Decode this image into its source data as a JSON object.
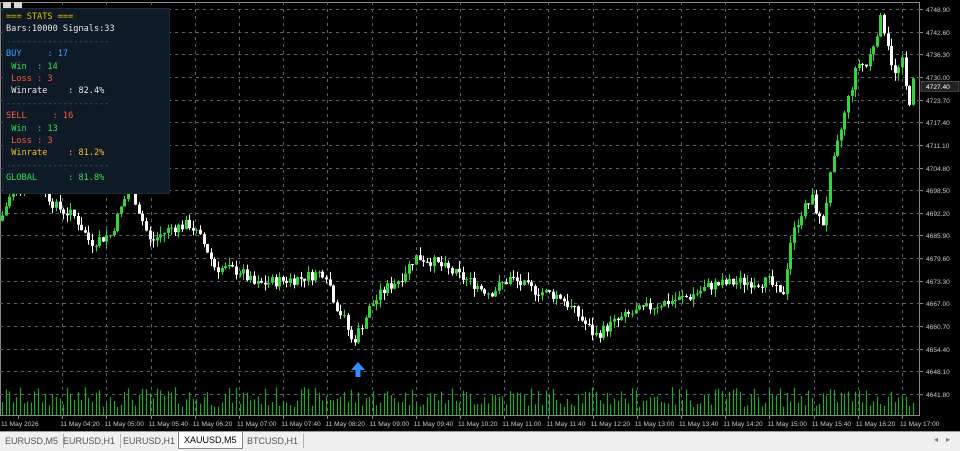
{
  "stats": {
    "title": "=== STATS ===",
    "bars_signals": "Bars:10000 Signals:33",
    "separator": "--------------------",
    "buy": {
      "label": "BUY",
      "count": "17",
      "win": "14",
      "loss": "3",
      "winrate": "82.4%"
    },
    "sell": {
      "label": "SELL",
      "count": "16",
      "win": "13",
      "loss": "3",
      "winrate": "81.2%"
    },
    "win_label": "Win",
    "loss_label": "Loss",
    "winrate_label": "Winrate",
    "global_label": "GLOBAL",
    "global_rate": "81.8%"
  },
  "price_axis": [
    "4748.90",
    "4742.60",
    "4736.30",
    "4730.00",
    "4723.70",
    "4717.40",
    "4711.10",
    "4704.80",
    "4698.50",
    "4692.20",
    "4685.90",
    "4679.60",
    "4673.30",
    "4667.00",
    "4660.70",
    "4654.40",
    "4648.10",
    "4641.80"
  ],
  "time_axis": [
    "11 May 2026",
    "11 May 04:20",
    "11 May 05:00",
    "11 May 05:40",
    "11 May 06:20",
    "11 May 07:00",
    "11 May 07:40",
    "11 May 08:20",
    "11 May 09:00",
    "11 May 09:40",
    "11 May 10:20",
    "11 May 11:00",
    "11 May 11:40",
    "11 May 12:20",
    "11 May 13:00",
    "11 May 13:40",
    "11 May 14:20",
    "11 May 15:00",
    "11 May 15:40",
    "11 May 16:20",
    "11 May 17:00"
  ],
  "current_price_label": "4727.40",
  "signal": {
    "type": "buy-arrow",
    "color": "#2f8fff"
  },
  "colors": {
    "bull": "#33d63a",
    "bear": "#ffffff",
    "grid": "#5a6470",
    "axis_text": "#c8c8c8",
    "volume": "#1fa82a",
    "background": "#000000"
  },
  "tabs": [
    {
      "label": "EURUSD,M5",
      "active": false
    },
    {
      "label": "EURUSD,H1",
      "active": false
    },
    {
      "label": "EURUSD,H1",
      "active": false
    },
    {
      "label": "XAUUSD,M5",
      "active": true
    },
    {
      "label": "BTCUSD,H1",
      "active": false
    }
  ],
  "tab_scroll": {
    "left_icon": "triangle-left-icon",
    "right_icon": "triangle-right-icon",
    "left": "◂",
    "right": "▸"
  }
}
